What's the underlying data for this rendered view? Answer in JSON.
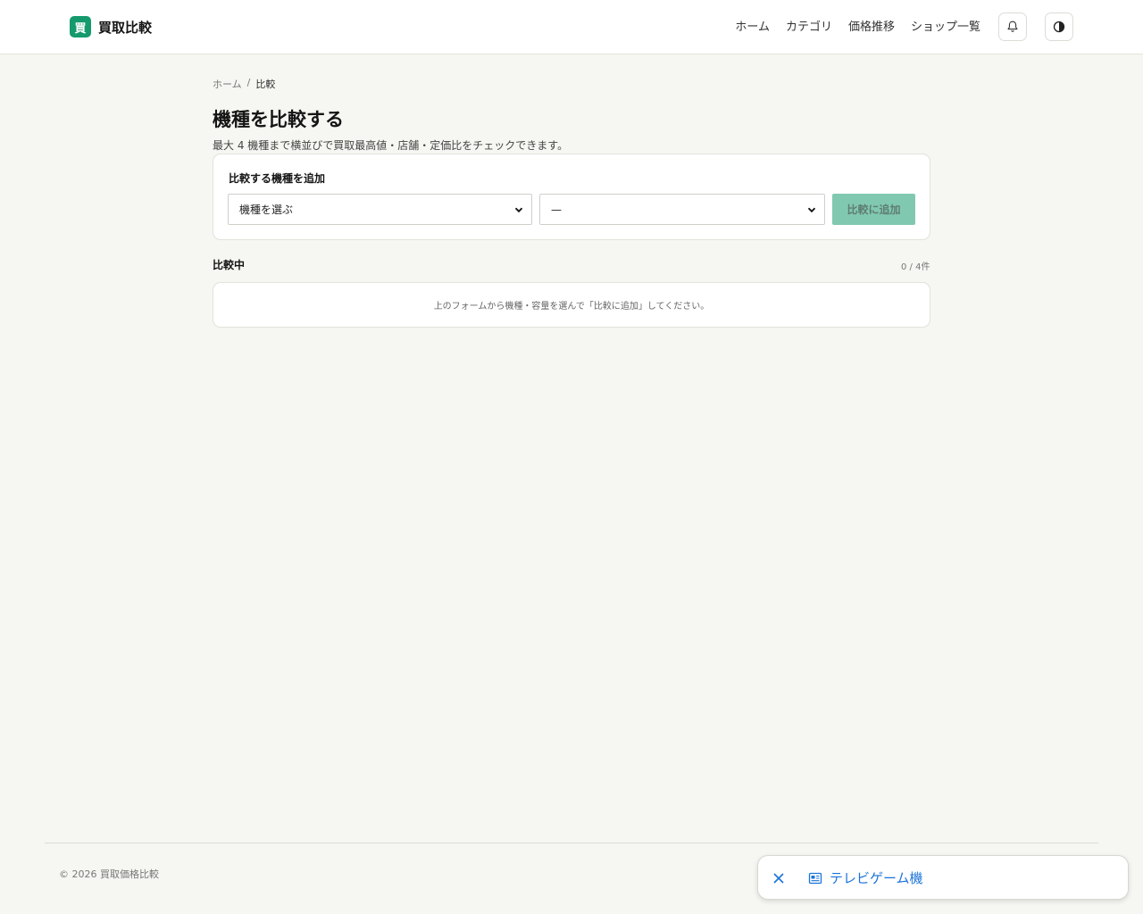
{
  "header": {
    "logo_mark": "買",
    "logo_text": "買取比較",
    "nav": [
      "ホーム",
      "カテゴリ",
      "価格推移",
      "ショップ一覧"
    ],
    "icons": [
      "bell-icon",
      "theme-toggle-icon"
    ]
  },
  "breadcrumb": {
    "home": "ホーム",
    "separator": "/",
    "current": "比較"
  },
  "page": {
    "title": "機種を比較する",
    "subtitle": "最大 4 機種まで横並びで買取最高値・店舗・定価比をチェックできます。"
  },
  "add_form": {
    "title": "比較する機種を追加",
    "model_select_value": "機種を選ぶ",
    "capacity_select_value": "—",
    "add_button_label": "比較に追加"
  },
  "compare": {
    "heading": "比較中",
    "count": "0 / 4件",
    "empty_message": "上のフォームから機種・容量を選んで「比較に追加」してください。"
  },
  "footer": {
    "copyright": "© 2026 買取価格比較"
  },
  "floating_chip": {
    "label": "テレビゲーム機"
  },
  "colors": {
    "accent": "#149a6c",
    "button_disabled": "#80c9b0",
    "link": "#1a73d9",
    "background": "#f6f6f2"
  }
}
